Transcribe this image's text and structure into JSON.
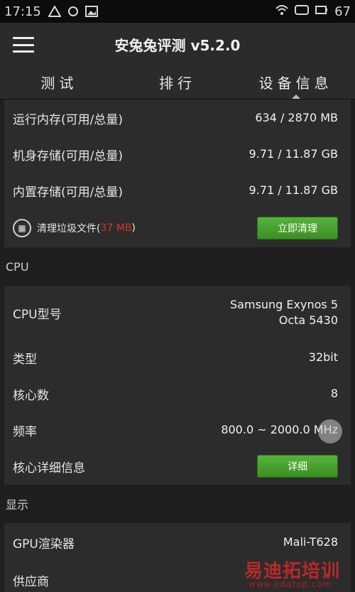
{
  "status": {
    "time": "17:15",
    "battery": "67"
  },
  "appbar": {
    "title": "安兔兔评测 v5.2.0"
  },
  "tabs": [
    {
      "label": "测试"
    },
    {
      "label": "排行"
    },
    {
      "label": "设备信息"
    }
  ],
  "memory": {
    "ram_label": "运行内存(可用/总量)",
    "ram_value": "634 / 2870 MB",
    "storage_label": "机身存储(可用/总量)",
    "storage_value": "9.71 / 11.87 GB",
    "internal_label": "内置存储(可用/总量)",
    "internal_value": "9.71 / 11.87 GB",
    "clean_label_prefix": "清理垃圾文件(",
    "clean_size": "37 MB",
    "clean_label_suffix": ")",
    "clean_button": "立即清理"
  },
  "cpu": {
    "section_title": "CPU",
    "model_label": "CPU型号",
    "model_value_line1": "Samsung Exynos 5",
    "model_value_line2": "Octa 5430",
    "type_label": "类型",
    "type_value": "32bit",
    "cores_label": "核心数",
    "cores_value": "8",
    "freq_label": "频率",
    "freq_value": "800.0 ~ 2000.0 MHz",
    "detail_label": "核心详细信息",
    "detail_button": "详细"
  },
  "display": {
    "section_title": "显示",
    "gpu_label": "GPU渲染器",
    "gpu_value": "Mali-T628",
    "vendor_label": "供应商"
  },
  "watermark": {
    "text": "易迪拓培训",
    "url": "www.edatop.com"
  }
}
